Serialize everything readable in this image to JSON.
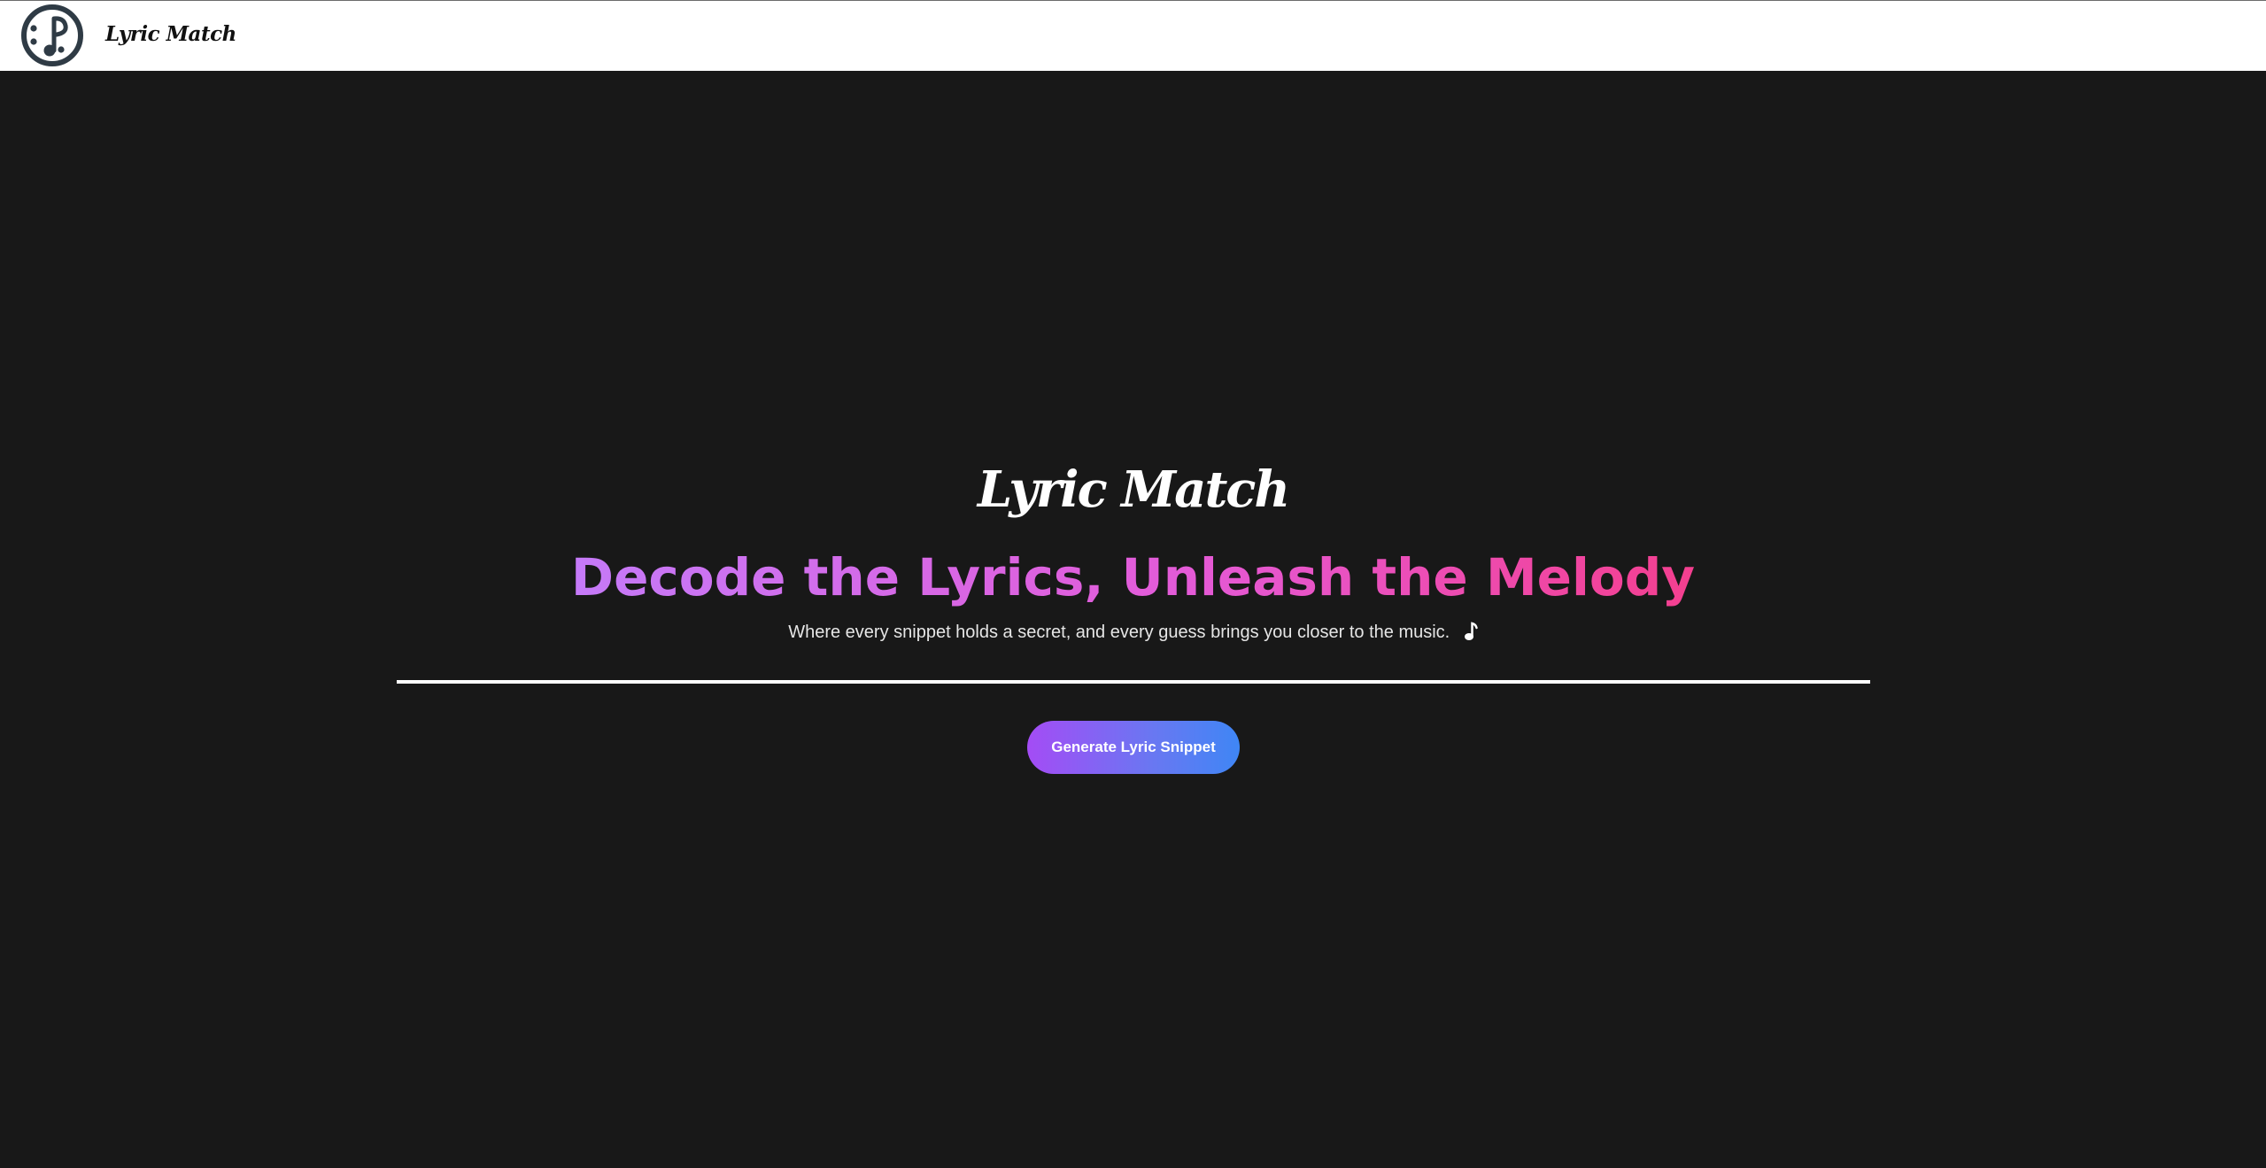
{
  "header": {
    "logo_icon": "music-note-circle-icon",
    "brand_name": "Lyric Match"
  },
  "hero": {
    "logo_text": "Lyric Match",
    "heading": "Decode the Lyrics, Unleash the Melody",
    "tagline": "Where every snippet holds a secret, and every guess brings you closer to the music.",
    "tagline_icon": "music-note-icon",
    "generate_button_label": "Generate Lyric Snippet"
  },
  "colors": {
    "page_background": "#181818",
    "header_background": "#ffffff",
    "heading_gradient": [
      "#c57af8",
      "#e45ad7",
      "#f43f8f"
    ],
    "button_gradient": [
      "#a44cf5",
      "#3f86f5"
    ],
    "logo_dark": "#2f3b45"
  }
}
